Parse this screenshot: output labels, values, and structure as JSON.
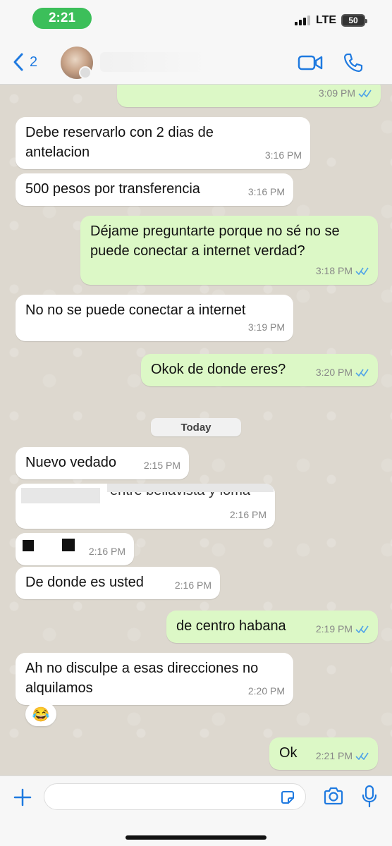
{
  "status_bar": {
    "time": "2:21",
    "network": "LTE",
    "battery": "50"
  },
  "header": {
    "back_count": "2"
  },
  "messages": [
    {
      "dir": "out",
      "text": "",
      "time": "3:09 PM"
    },
    {
      "dir": "in",
      "text": "Debe reservarlo con 2 dias de antelacion",
      "time": "3:16 PM"
    },
    {
      "dir": "in",
      "text": "500 pesos por transferencia",
      "time": "3:16 PM"
    },
    {
      "dir": "out",
      "text": "Déjame preguntarte porque no sé no se puede conectar a internet verdad?",
      "time": "3:18 PM"
    },
    {
      "dir": "in",
      "text": "No no se puede conectar a internet",
      "time": "3:19 PM"
    },
    {
      "dir": "out",
      "text": "Okok de donde eres?",
      "time": "3:20 PM"
    },
    {
      "dir": "in",
      "text": "Nuevo vedado",
      "time": "2:15 PM"
    },
    {
      "dir": "in",
      "text": "entre bellavista y loma",
      "time": "2:16 PM"
    },
    {
      "dir": "in",
      "text": "",
      "time": "2:16 PM"
    },
    {
      "dir": "in",
      "text": "De donde es usted",
      "time": "2:16 PM"
    },
    {
      "dir": "out",
      "text": "de centro habana",
      "time": "2:19 PM"
    },
    {
      "dir": "in",
      "text": "Ah no disculpe a esas direcciones no alquilamos",
      "time": "2:20 PM"
    },
    {
      "dir": "out",
      "text": "Ok",
      "time": "2:21 PM"
    }
  ],
  "date_separator": "Today",
  "reaction_emoji": "😂",
  "colors": {
    "incoming": "#ffffff",
    "outgoing": "#dcf8c6",
    "accent": "#1f7ae0",
    "time_pill": "#3cbf5a",
    "read_ticks": "#4fa3e8"
  },
  "icons": [
    "back-chevron-icon",
    "video-call-icon",
    "phone-icon",
    "plus-icon",
    "sticker-icon",
    "camera-icon",
    "microphone-icon"
  ]
}
